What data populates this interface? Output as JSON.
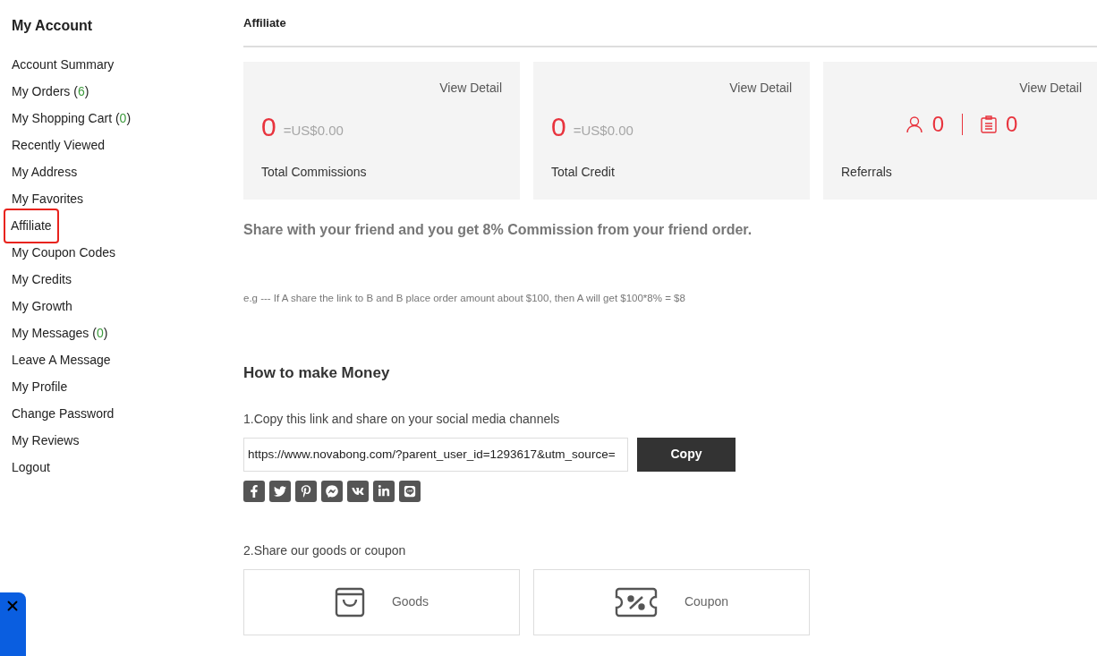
{
  "sidebar": {
    "title": "My Account",
    "items": [
      {
        "label": "Account Summary",
        "selected": false
      },
      {
        "label": "My Orders (",
        "count": "6",
        "suffix": ")",
        "selected": false
      },
      {
        "label": "My Shopping Cart (",
        "count": "0",
        "suffix": ")",
        "selected": false
      },
      {
        "label": "Recently Viewed",
        "selected": false
      },
      {
        "label": "My Address",
        "selected": false
      },
      {
        "label": "My Favorites",
        "selected": false
      },
      {
        "label": "Affiliate",
        "selected": true
      },
      {
        "label": "My Coupon Codes",
        "selected": false
      },
      {
        "label": "My Credits",
        "selected": false
      },
      {
        "label": "My Growth",
        "selected": false
      },
      {
        "label": "My Messages (",
        "count": "0",
        "suffix": ")",
        "selected": false
      },
      {
        "label": "Leave A Message",
        "selected": false
      },
      {
        "label": "My Profile",
        "selected": false
      },
      {
        "label": "Change Password",
        "selected": false
      },
      {
        "label": "My Reviews",
        "selected": false
      },
      {
        "label": "Logout",
        "selected": false
      }
    ]
  },
  "page_title": "Affiliate",
  "cards": [
    {
      "kind": "amount",
      "link": "View Detail",
      "value": "0",
      "equivalent": "=US$0.00",
      "label": "Total Commissions"
    },
    {
      "kind": "amount",
      "link": "View Detail",
      "value": "0",
      "equivalent": "=US$0.00",
      "label": "Total Credit"
    },
    {
      "kind": "referrals",
      "link": "View Detail",
      "users": "0",
      "orders": "0",
      "label": "Referrals"
    }
  ],
  "headline": "Share with your friend and you get 8% Commission from your friend order.",
  "example": "e.g --- If A share the link to B and B place order amount about $100, then A will get $100*8% = $8",
  "how_title": "How to make Money",
  "step1": "1.Copy this link and share on your social media channels",
  "link_value": "https://www.novabong.com/?parent_user_id=1293617&utm_source=",
  "copy_button": "Copy",
  "step2": "2.Share our goods or coupon",
  "share_options": [
    {
      "kind": "goods",
      "label": "Goods"
    },
    {
      "kind": "coupon",
      "label": "Coupon"
    }
  ]
}
